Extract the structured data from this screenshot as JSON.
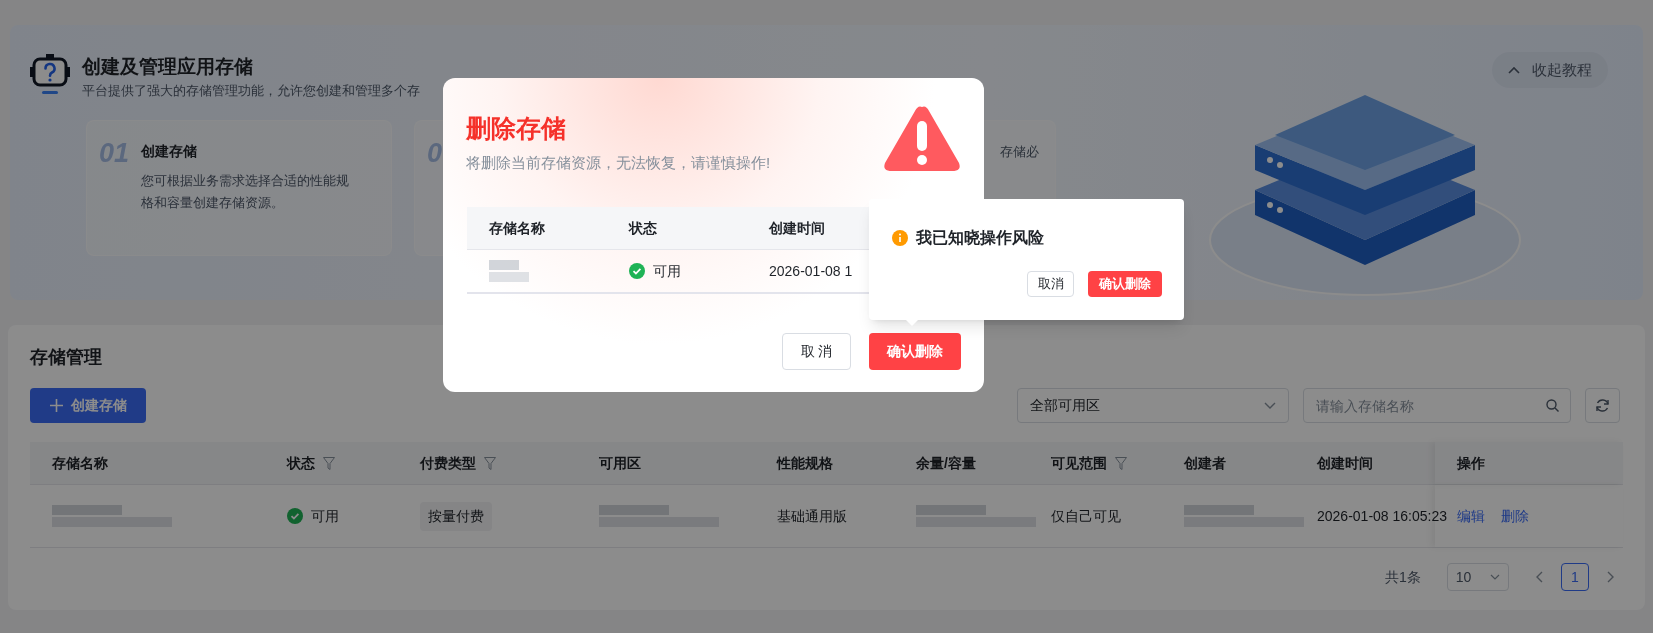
{
  "banner": {
    "title": "创建及管理应用存储",
    "description": "平台提供了强大的存储管理功能，允许您创建和管理多个存",
    "collapse_button": "收起教程",
    "steps": [
      {
        "number": "01",
        "title": "创建存储",
        "description": "您可根据业务需求选择合适的性能规格和容量创建存储资源。"
      },
      {
        "number": "0"
      },
      {
        "description": "存储必"
      }
    ]
  },
  "panel": {
    "title": "存储管理",
    "create_button": "创建存储",
    "zone_select": "全部可用区",
    "search": {
      "placeholder": "请输入存储名称"
    },
    "table": {
      "columns": [
        {
          "label": "存储名称",
          "filter": false
        },
        {
          "label": "状态",
          "filter": true
        },
        {
          "label": "付费类型",
          "filter": true
        },
        {
          "label": "可用区",
          "filter": false
        },
        {
          "label": "性能规格",
          "filter": false
        },
        {
          "label": "余量/容量",
          "filter": false
        },
        {
          "label": "可见范围",
          "filter": true
        },
        {
          "label": "创建者",
          "filter": false
        },
        {
          "label": "创建时间",
          "filter": false
        },
        {
          "label": "操作",
          "filter": false
        }
      ],
      "rows": [
        {
          "cells": [
            {
              "kind": "redacted"
            },
            {
              "kind": "status",
              "text": "可用"
            },
            {
              "kind": "tag",
              "text": "按量付费"
            },
            {
              "kind": "redacted"
            },
            {
              "kind": "text",
              "text": "基础通用版"
            },
            {
              "kind": "redacted"
            },
            {
              "kind": "text",
              "text": "仅自己可见"
            },
            {
              "kind": "redacted"
            },
            {
              "kind": "text",
              "text": "2026-01-08 16:05:23"
            },
            {
              "kind": "actions",
              "links": [
                "编辑",
                "删除"
              ]
            }
          ]
        }
      ]
    },
    "pagination": {
      "total": "共1条",
      "page_size": "10",
      "pages": [
        {
          "label": "1",
          "selected": true
        }
      ]
    }
  },
  "modal": {
    "title": "删除存储",
    "subtitle": "将删除当前存储资源，无法恢复，请谨慎操作!",
    "columns": [
      "存储名称",
      "状态",
      "创建时间"
    ],
    "row": [
      {
        "kind": "redacted"
      },
      {
        "kind": "status",
        "text": "可用"
      },
      {
        "kind": "text",
        "text": "2026-01-08 1"
      }
    ],
    "cancel_button": "取 消",
    "confirm_button": "确认删除"
  },
  "popover": {
    "message": "我已知晓操作风险",
    "cancel_button": "取消",
    "confirm_button": "确认删除"
  }
}
